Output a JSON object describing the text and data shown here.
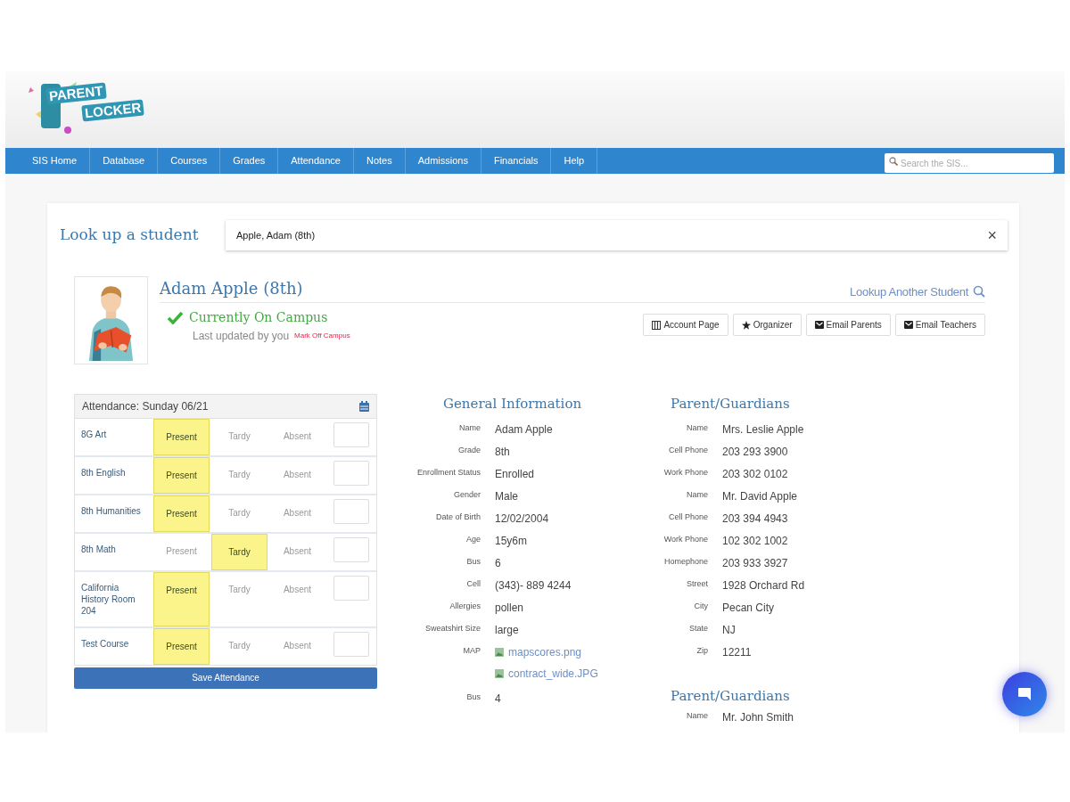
{
  "logo": {
    "line_1": "PARENT",
    "line_2": "LOCKER"
  },
  "nav": {
    "items": [
      {
        "label": "SIS Home",
        "selected": false
      },
      {
        "label": "Database",
        "selected": false
      },
      {
        "label": "Courses",
        "selected": false
      },
      {
        "label": "Grades",
        "selected": false
      },
      {
        "label": "Attendance",
        "selected": false
      },
      {
        "label": "Notes",
        "selected": false
      },
      {
        "label": "Admissions",
        "selected": false
      },
      {
        "label": "Financials",
        "selected": false
      },
      {
        "label": "Help",
        "selected": false
      }
    ],
    "search": {
      "placeholder": "Search the SIS..."
    }
  },
  "lookup": {
    "title": "Look up a student",
    "value": "Apple, Adam (8th)",
    "clear": "×"
  },
  "student": {
    "name": "Adam Apple (8th)",
    "lookup_link": "Lookup Another Student",
    "on_campus": true,
    "status": "Currently On Campus",
    "updated": "Last updated by you",
    "mark_link": "Mark Off Campus",
    "buttons": [
      {
        "label": "Account Page",
        "kind": "account"
      },
      {
        "label": "Organizer",
        "kind": "star"
      },
      {
        "label": "Email Parents",
        "kind": "mail"
      },
      {
        "label": "Email Teachers",
        "kind": "mail"
      }
    ]
  },
  "attendance": {
    "title": "Attendance: Sunday 06/21",
    "save": "Save Attendance",
    "rows": [
      {
        "course": "8G Art",
        "options": [
          {
            "label": "Present",
            "selected": true
          },
          {
            "label": "Tardy",
            "selected": false
          },
          {
            "label": "Absent",
            "selected": false
          }
        ]
      },
      {
        "course": "8th English",
        "options": [
          {
            "label": "Present",
            "selected": true
          },
          {
            "label": "Tardy",
            "selected": false
          },
          {
            "label": "Absent",
            "selected": false
          }
        ]
      },
      {
        "course": "8th Humanities",
        "options": [
          {
            "label": "Present",
            "selected": true
          },
          {
            "label": "Tardy",
            "selected": false
          },
          {
            "label": "Absent",
            "selected": false
          }
        ]
      },
      {
        "course": "8th Math",
        "options": [
          {
            "label": "Present",
            "selected": false
          },
          {
            "label": "Tardy",
            "selected": true
          },
          {
            "label": "Absent",
            "selected": false
          }
        ]
      },
      {
        "course": "California History Room 204",
        "options": [
          {
            "label": "Present",
            "selected": true
          },
          {
            "label": "Tardy",
            "selected": false
          },
          {
            "label": "Absent",
            "selected": false
          }
        ]
      },
      {
        "course": "Test Course",
        "options": [
          {
            "label": "Present",
            "selected": true
          },
          {
            "label": "Tardy",
            "selected": false
          },
          {
            "label": "Absent",
            "selected": false
          }
        ]
      }
    ]
  },
  "general": {
    "title": "General Information",
    "rows": [
      {
        "label": "Name",
        "value": "Adam Apple",
        "kind": "text"
      },
      {
        "label": "Grade",
        "value": "8th",
        "kind": "text"
      },
      {
        "label": "Enrollment Status",
        "value": "Enrolled",
        "kind": "text"
      },
      {
        "label": "Gender",
        "value": "Male",
        "kind": "text"
      },
      {
        "label": "Date of Birth",
        "value": "12/02/2004",
        "kind": "text"
      },
      {
        "label": "Age",
        "value": "15y6m",
        "kind": "text"
      },
      {
        "label": "Bus",
        "value": "6",
        "kind": "text"
      },
      {
        "label": "Cell",
        "value": "(343)- 889 4244",
        "kind": "text"
      },
      {
        "label": "Allergies",
        "value": "pollen",
        "kind": "text"
      },
      {
        "label": "Sweatshirt Size",
        "value": "large",
        "kind": "text"
      },
      {
        "label": "MAP",
        "files": [
          "mapscores.png",
          "contract_wide.JPG"
        ],
        "kind": "files"
      },
      {
        "label": "Bus",
        "value": "4",
        "kind": "text"
      }
    ]
  },
  "guardians": [
    {
      "title": "Parent/Guardians",
      "rows": [
        {
          "label": "Name",
          "value": "Mrs. Leslie Apple"
        },
        {
          "label": "Cell Phone",
          "value": "203 293 3900"
        },
        {
          "label": "Work Phone",
          "value": "203 302 0102"
        },
        {
          "label": "Name",
          "value": "Mr. David Apple"
        },
        {
          "label": "Cell Phone",
          "value": "203 394 4943"
        },
        {
          "label": "Work Phone",
          "value": "102 302 1002"
        },
        {
          "label": "Homephone",
          "value": "203 933 3927"
        },
        {
          "label": "Street",
          "value": "1928 Orchard Rd"
        },
        {
          "label": "City",
          "value": "Pecan City"
        },
        {
          "label": "State",
          "value": "NJ"
        },
        {
          "label": "Zip",
          "value": "12211"
        }
      ]
    },
    {
      "title": "Parent/Guardians",
      "rows": [
        {
          "label": "Name",
          "value": "Mr. John Smith"
        }
      ]
    }
  ]
}
